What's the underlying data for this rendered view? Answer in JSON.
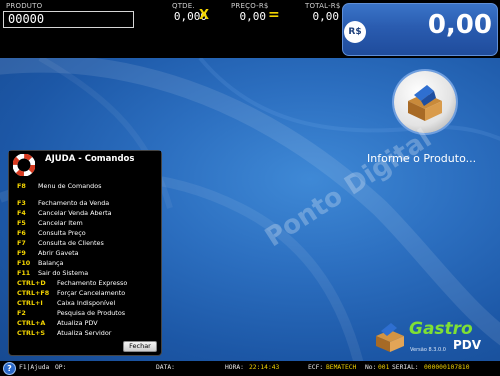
{
  "topbar": {
    "produto_label": "PRODUTO",
    "produto_value": "00000",
    "qtde_label": "QTDE.",
    "qtde_value": "0,000",
    "qtde_op": "X",
    "preco_label": "PREÇO-R$",
    "preco_value": "0,00",
    "preco_op": "=",
    "total_label": "TOTAL-R$",
    "total_value": "0,00",
    "currency_badge": "R$",
    "total_big": "0,00"
  },
  "main": {
    "prompt_text": "Informe o Produto...",
    "watermark": "Ponto Digital",
    "brand": {
      "name": "Gastro",
      "sub": "PDV",
      "version": "Versão 8.3.0.0"
    }
  },
  "help_dialog": {
    "title": "AJUDA - Comandos",
    "commands": [
      {
        "key": "F8",
        "desc": "Menu de Comandos"
      },
      {
        "key": "F3",
        "desc": "Fechamento da Venda"
      },
      {
        "key": "F4",
        "desc": "Cancelar Venda Aberta"
      },
      {
        "key": "F5",
        "desc": "Cancelar Item"
      },
      {
        "key": "F6",
        "desc": "Consulta Preço"
      },
      {
        "key": "F7",
        "desc": "Consulta de Clientes"
      },
      {
        "key": "F9",
        "desc": "Abrir Gaveta"
      },
      {
        "key": "F10",
        "desc": "Balança"
      },
      {
        "key": "F11",
        "desc": "Sair do Sistema"
      },
      {
        "key": "CTRL+D",
        "desc": "Fechamento Expresso"
      },
      {
        "key": "CTRL+F8",
        "desc": "Forçar Cancelamento"
      },
      {
        "key": "CTRL+I",
        "desc": "Caixa Indisponível"
      },
      {
        "key": "F2",
        "desc": "Pesquisa de Produtos"
      },
      {
        "key": "CTRL+A",
        "desc": "Atualiza PDV"
      },
      {
        "key": "CTRL+S",
        "desc": "Atualiza Servidor"
      }
    ],
    "close_label": "Fechar"
  },
  "statusbar": {
    "help_icon": "?",
    "help_text": "F1|Ajuda",
    "op_label": "OP:",
    "data_label": "DATA:",
    "hora_label": "HORA:",
    "hora_value": "22:14:43",
    "ecf_label": "ECF:",
    "ecf_value": "BEMATECH",
    "no_label": "No:",
    "no_value": "001",
    "serial_label": "SERIAL:",
    "serial_value": "000000107810"
  },
  "colors": {
    "accent_yellow": "#f3d400",
    "brand_green": "#7fe034",
    "total_panel_blue": "#2a5cb0",
    "desktop_blue": "#2c6fc0"
  }
}
